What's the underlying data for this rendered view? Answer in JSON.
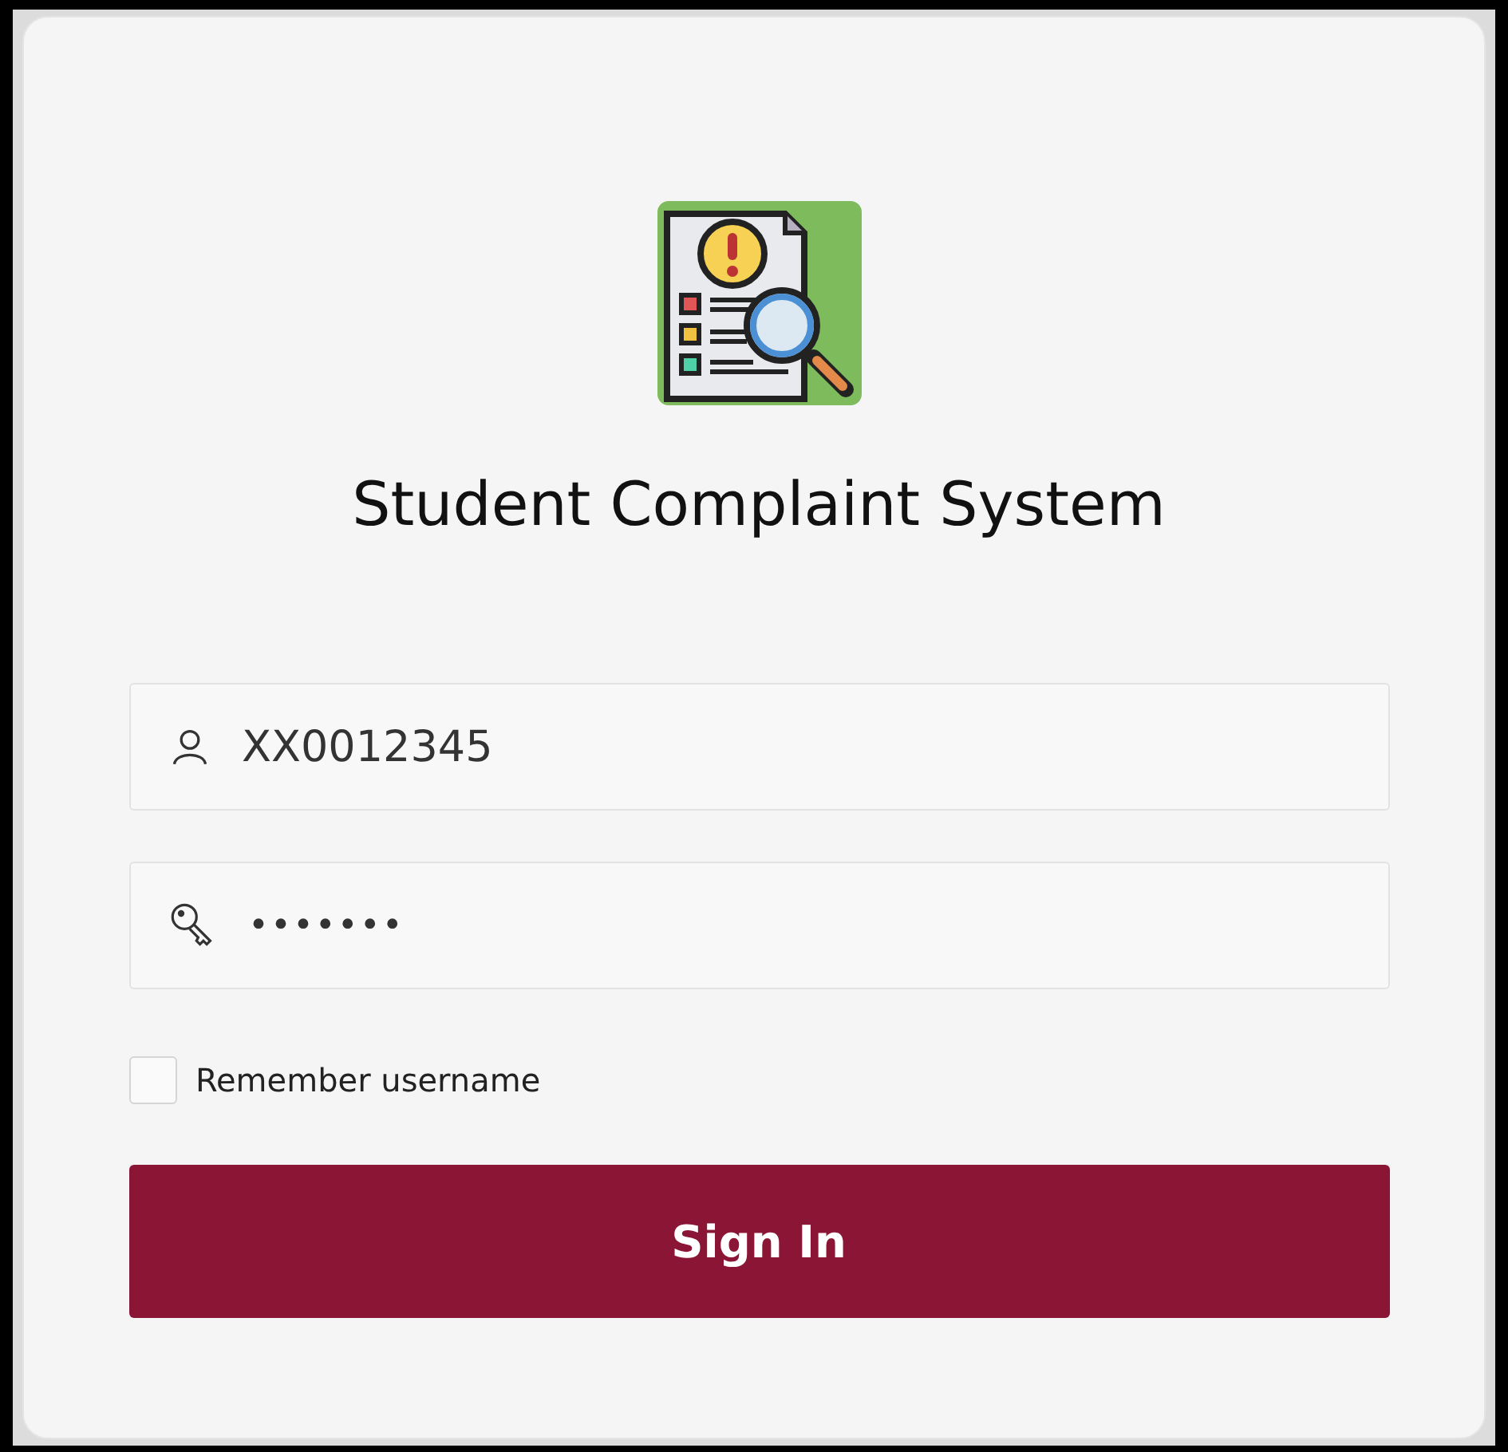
{
  "title": "Student Complaint System",
  "username": {
    "value": "XX0012345"
  },
  "password": {
    "value": "•••••••"
  },
  "remember": {
    "label": "Remember username",
    "checked": false
  },
  "button": {
    "label": "Sign In"
  }
}
